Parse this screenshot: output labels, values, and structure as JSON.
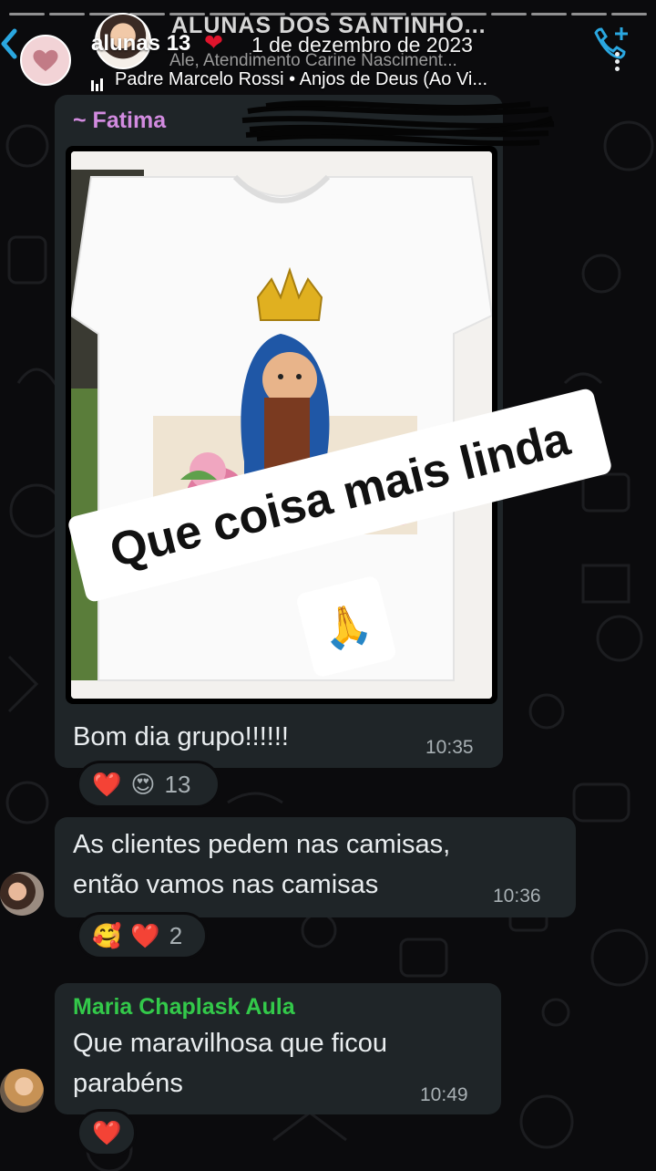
{
  "story": {
    "user_name": "alunas 13",
    "heart": "❤",
    "date": "1 de dezembro de 2023",
    "music": "Padre Marcelo Rossi • Anjos de Deus (Ao Vi..."
  },
  "chat": {
    "title": "ALUNAS DOS SANTINHO...",
    "subtitle": "Ale, Atendimento Carine Nasciment..."
  },
  "messages": [
    {
      "sender": "~ Fatima",
      "text": "Bom dia grupo!!!!!!",
      "time": "10:35",
      "reactions": [
        "❤️",
        "😍"
      ],
      "reaction_count": "13",
      "image": "t-shirt-with-virgin-mary-painting"
    },
    {
      "text_line1": "As clientes pedem nas camisas,",
      "text_line2": "então vamos nas camisas",
      "time": "10:36",
      "reactions": [
        "🥰",
        "❤️"
      ],
      "reaction_count": "2"
    },
    {
      "sender": "Maria Chaplask Aula",
      "text_line1": "Que maravilhosa  que ficou",
      "text_line2": "parabéns",
      "time": "10:49",
      "reactions": [
        "❤️"
      ]
    }
  ],
  "sticker": {
    "text": "Que coisa mais linda",
    "emoji": "🙏"
  },
  "colors": {
    "background": "#0b0b0d",
    "bubble": "#1f2528",
    "sender_fatima": "#d28be0",
    "sender_maria": "#33c94a",
    "heart": "#e0142c"
  },
  "icons": [
    "back-arrow-icon",
    "call-add-icon",
    "menu-dots-icon",
    "forward-icon",
    "music-bars-icon"
  ]
}
